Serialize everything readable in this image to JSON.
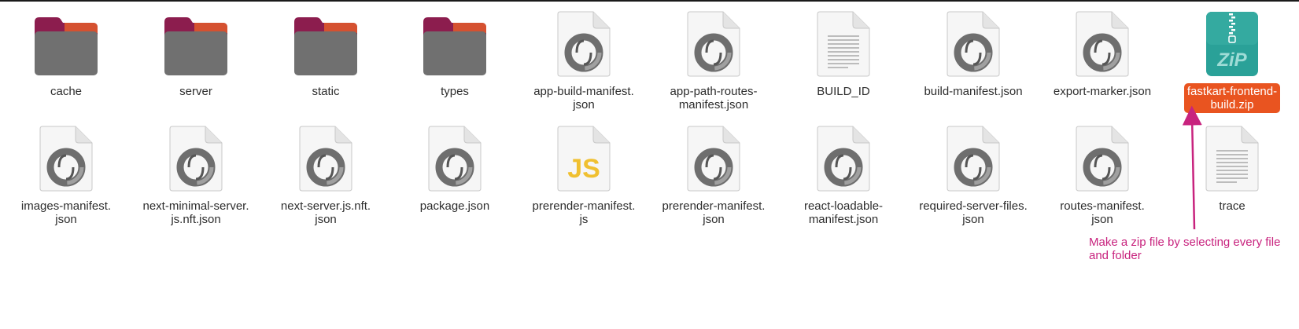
{
  "files": [
    {
      "name": "cache",
      "type": "folder"
    },
    {
      "name": "server",
      "type": "folder"
    },
    {
      "name": "static",
      "type": "folder"
    },
    {
      "name": "types",
      "type": "folder"
    },
    {
      "name": "app-build-manifest.\njson",
      "type": "json"
    },
    {
      "name": "app-path-routes-\nmanifest.json",
      "type": "json"
    },
    {
      "name": "BUILD_ID",
      "type": "text"
    },
    {
      "name": "build-manifest.json",
      "type": "json"
    },
    {
      "name": "export-marker.json",
      "type": "json"
    },
    {
      "name": "fastkart-frontend-\nbuild.zip",
      "type": "zip",
      "selected": true
    },
    {
      "name": "images-manifest.\njson",
      "type": "json"
    },
    {
      "name": "next-minimal-server.\njs.nft.json",
      "type": "json"
    },
    {
      "name": "next-server.js.nft.\njson",
      "type": "json"
    },
    {
      "name": "package.json",
      "type": "json"
    },
    {
      "name": "prerender-manifest.\njs",
      "type": "js"
    },
    {
      "name": "prerender-manifest.\njson",
      "type": "json"
    },
    {
      "name": "react-loadable-\nmanifest.json",
      "type": "json"
    },
    {
      "name": "required-server-files.\njson",
      "type": "json"
    },
    {
      "name": "routes-manifest.\njson",
      "type": "json"
    },
    {
      "name": "trace",
      "type": "text"
    }
  ],
  "annotation": {
    "text": "Make a zip file by selecting every file and folder",
    "color": "#c8237e"
  },
  "icons": {
    "folder": "folder-icon",
    "json": "json-file-icon",
    "text": "text-file-icon",
    "zip": "zip-archive-icon",
    "js": "javascript-file-icon"
  },
  "colors": {
    "selection": "#e95420",
    "folder_tab": "#8c1d4e",
    "folder_tab_top": "#e25a2b",
    "folder_body": "#707070",
    "zip": "#2aa198",
    "js": "#f0c030"
  },
  "zip_badge": "ZiP",
  "js_badge": "JS"
}
